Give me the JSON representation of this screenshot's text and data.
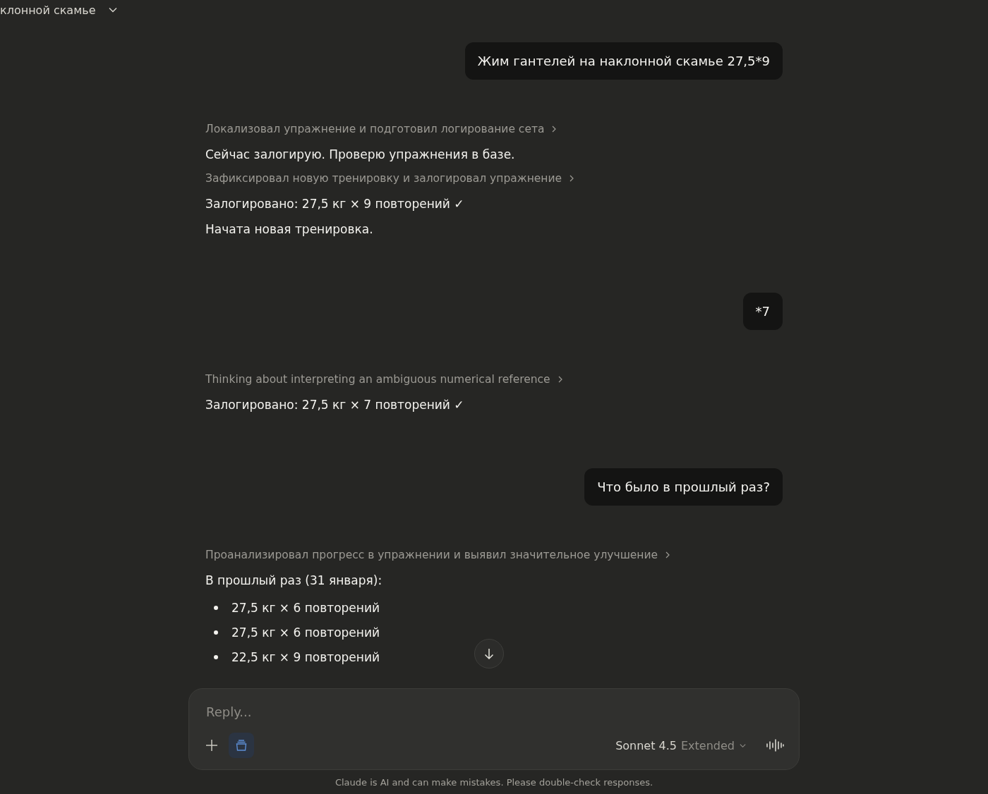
{
  "header": {
    "title": "клонной скамье"
  },
  "messages": [
    {
      "kind": "user",
      "text": "Жим гантелей на наклонной скамье 27,5*9"
    },
    {
      "kind": "assistant",
      "blocks": [
        {
          "kind": "thought",
          "text": "Локализовал упражнение и подготовил логирование сета"
        },
        {
          "kind": "text",
          "text": "Сейчас залогирую. Проверю упражнения в базе."
        },
        {
          "kind": "thought",
          "text": "Зафиксировал новую тренировку и залогировал упражнение"
        },
        {
          "kind": "text",
          "text": "Залогировано: 27,5 кг × 9 повторений ✓"
        },
        {
          "kind": "text",
          "text": "Начата новая тренировка."
        }
      ]
    },
    {
      "kind": "user",
      "text": "*7"
    },
    {
      "kind": "assistant",
      "blocks": [
        {
          "kind": "thought",
          "text": "Thinking about interpreting an ambiguous numerical reference"
        },
        {
          "kind": "text",
          "text": "Залогировано: 27,5 кг × 7 повторений ✓"
        }
      ]
    },
    {
      "kind": "user",
      "text": "Что было в прошлый раз?"
    },
    {
      "kind": "assistant",
      "blocks": [
        {
          "kind": "thought",
          "text": "Проанализировал прогресс в упражнении и выявил значительное улучшение"
        },
        {
          "kind": "text",
          "text": "В прошлый раз (31 января):"
        },
        {
          "kind": "bullets",
          "items": [
            "27,5 кг × 6 повторений",
            "27,5 кг × 6 повторений",
            "22,5 кг × 9 повторений"
          ]
        }
      ]
    }
  ],
  "composer": {
    "placeholder": "Reply...",
    "model": "Sonnet 4.5",
    "mode": "Extended",
    "tools_active": true
  },
  "disclaimer": "Claude is AI and can make mistakes. Please double-check responses."
}
